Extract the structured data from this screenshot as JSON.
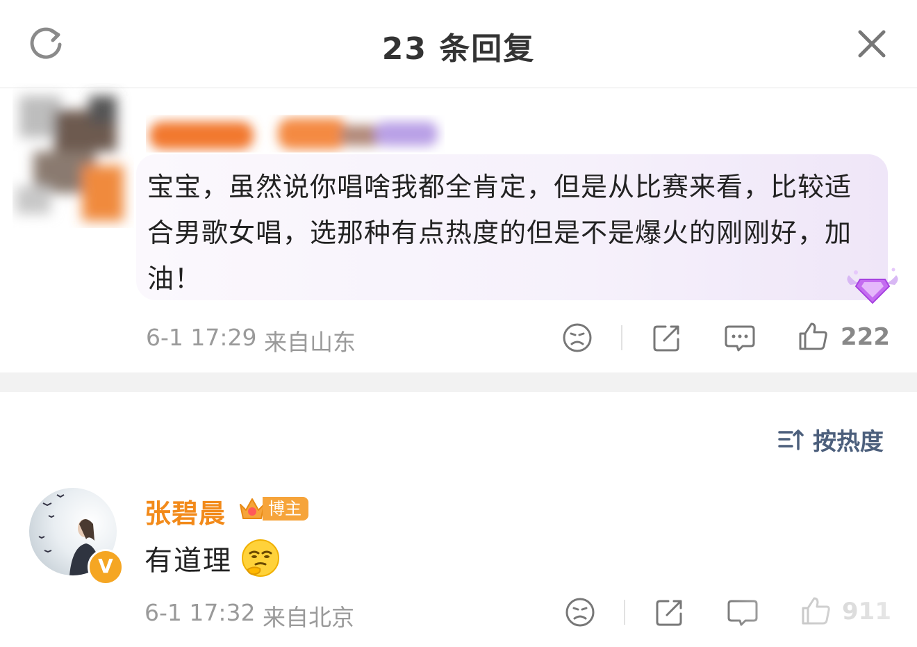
{
  "header": {
    "title": "23 条回复"
  },
  "comment": {
    "text": "宝宝，虽然说你唱啥我都全肯定，但是从比赛来看，比较适合男歌女唱，选那种有点热度的但是不是爆火的刚刚好，加油！",
    "time": "6-1 17:29",
    "location": "来自山东",
    "likes": "222"
  },
  "sort": {
    "label": "按热度"
  },
  "reply": {
    "author": "张碧晨",
    "badge": "博主",
    "text": "有道理",
    "time": "6-1 17:32",
    "location": "来自北京",
    "likes": "911",
    "verified_glyph": "V"
  },
  "colors": {
    "accent_orange": "#f28a1a",
    "sort_blue": "#4c5f7c",
    "meta_gray": "#9a9a9a"
  },
  "icons": [
    "refresh-icon",
    "close-icon",
    "dislike-face-icon",
    "share-icon",
    "comment-icon",
    "thumbs-up-icon",
    "sort-icon",
    "gem-badge-icon",
    "crown-icon",
    "verified-icon",
    "thinking-emoji-icon"
  ]
}
